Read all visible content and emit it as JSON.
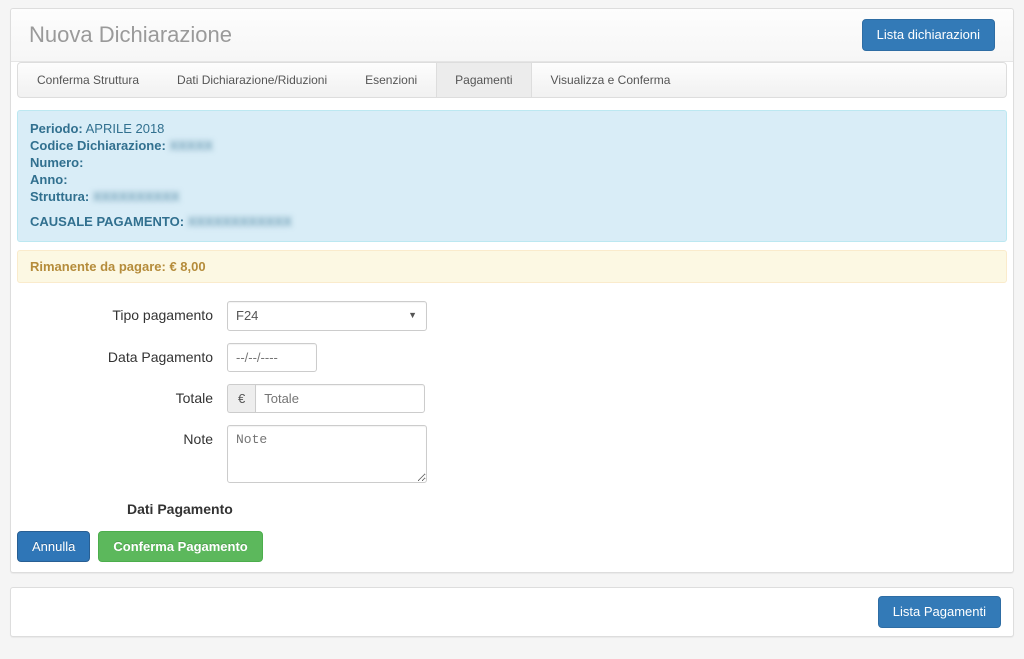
{
  "header": {
    "title": "Nuova Dichiarazione",
    "list_button": "Lista dichiarazioni"
  },
  "tabs": {
    "t0": "Conferma Struttura",
    "t1": "Dati Dichiarazione/Riduzioni",
    "t2": "Esenzioni",
    "t3": "Pagamenti",
    "t4": "Visualizza e Conferma"
  },
  "info": {
    "periodo_label": "Periodo:",
    "periodo_value": "APRILE 2018",
    "codice_label": "Codice Dichiarazione:",
    "codice_value": "XXXXX",
    "numero_label": "Numero:",
    "numero_value": "",
    "anno_label": "Anno:",
    "anno_value": "",
    "struttura_label": "Struttura:",
    "struttura_value": "XXXXXXXXXX",
    "causale_label": "CAUSALE PAGAMENTO:",
    "causale_value": "XXXXXXXXXXXX"
  },
  "remaining": {
    "label": "Rimanente da pagare: ",
    "value": "€ 8,00"
  },
  "form": {
    "tipo_label": "Tipo pagamento",
    "tipo_value": "F24",
    "data_label": "Data Pagamento",
    "data_placeholder": "--/--/----",
    "totale_label": "Totale",
    "totale_addon": "€",
    "totale_placeholder": "Totale",
    "note_label": "Note",
    "note_placeholder": "Note",
    "section_title": "Dati Pagamento",
    "cancel_btn": "Annulla",
    "confirm_btn": "Conferma Pagamento"
  },
  "footer": {
    "list_payments_btn": "Lista Pagamenti"
  }
}
